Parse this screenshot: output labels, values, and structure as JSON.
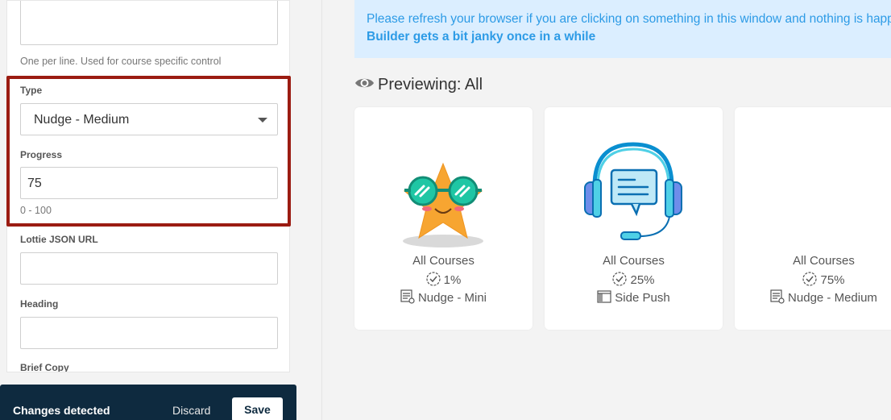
{
  "form": {
    "textarea_help": "One per line. Used for course specific control",
    "type_label": "Type",
    "type_value": "Nudge - Medium",
    "progress_label": "Progress",
    "progress_value": "75",
    "progress_help": "0 - 100",
    "lottie_label": "Lottie JSON URL",
    "heading_label": "Heading",
    "brief_label": "Brief Copy"
  },
  "changes_bar": {
    "text": "Changes detected",
    "discard": "Discard",
    "save": "Save"
  },
  "notice": {
    "line1": "Please refresh your browser if you are clicking on something in this window and nothing is happening. The",
    "line2": "Builder gets a bit janky once in a while"
  },
  "preview": {
    "title": "Previewing: All",
    "icon": "eye-icon",
    "cards": [
      {
        "scope": "All Courses",
        "progress": "1%",
        "type": "Nudge - Mini",
        "art": "star-sunglasses-illustration",
        "type_icon": "nudge-icon"
      },
      {
        "scope": "All Courses",
        "progress": "25%",
        "type": "Side Push",
        "art": "headset-chat-illustration",
        "type_icon": "side-push-icon"
      },
      {
        "scope": "All Courses",
        "progress": "75%",
        "type": "Nudge - Medium",
        "art": "",
        "type_icon": "nudge-icon"
      }
    ]
  },
  "colors": {
    "highlight": "#9b1c12",
    "bar": "#0e2a3f",
    "notice_bg": "#dbeeff",
    "notice_text": "#2d9be6"
  }
}
